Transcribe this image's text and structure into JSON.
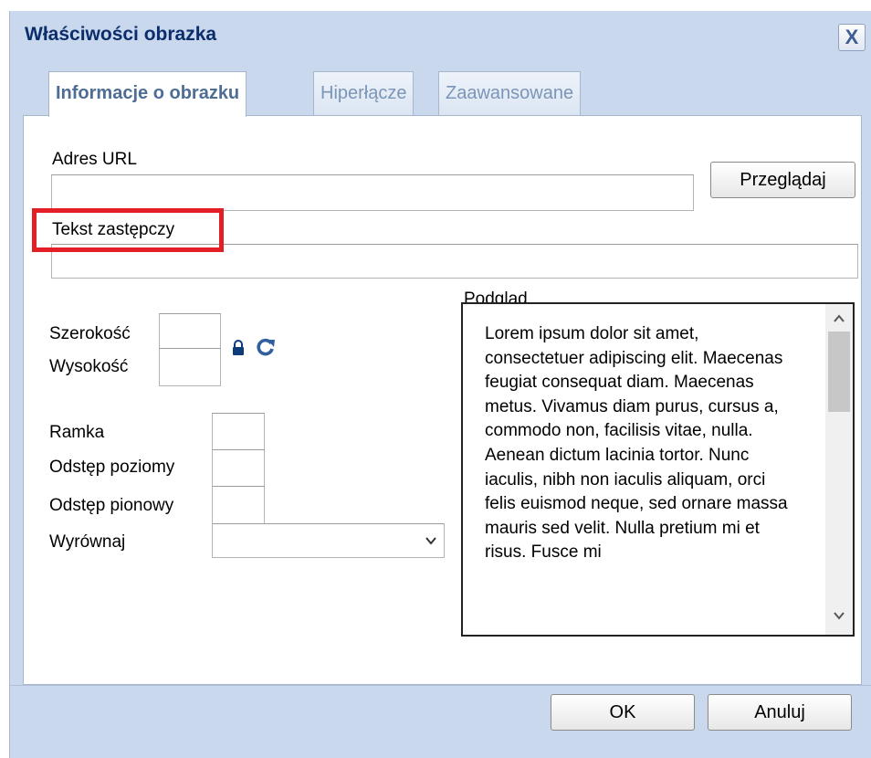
{
  "dialog": {
    "title": "Właściwości obrazka",
    "close_label": "X"
  },
  "tabs": [
    {
      "label": "Informacje o obrazku",
      "active": true
    },
    {
      "label": "Hiperłącze",
      "active": false
    },
    {
      "label": "Zaawansowane",
      "active": false
    }
  ],
  "fields": {
    "url_label": "Adres URL",
    "url_value": "",
    "browse_label": "Przeglądaj",
    "alt_label": "Tekst zastępczy",
    "alt_value": "",
    "width_label": "Szerokość",
    "height_label": "Wysokość",
    "border_label": "Ramka",
    "hspace_label": "Odstęp poziomy",
    "vspace_label": "Odstęp pionowy",
    "align_label": "Wyrównaj",
    "align_value": ""
  },
  "icons": {
    "lock": "lock-icon",
    "reset": "reset-size-icon",
    "dropdown": "chevron-down-icon"
  },
  "preview": {
    "label": "Podgląd",
    "text": "Lorem ipsum dolor sit amet, consectetuer adipiscing elit. Maecenas feugiat consequat diam. Maecenas metus. Vivamus diam purus, cursus a, commodo non, facilisis vitae, nulla. Aenean dictum lacinia tortor. Nunc iaculis, nibh non iaculis aliquam, orci felis euismod neque, sed ornare massa mauris sed velit. Nulla pretium mi et risus. Fusce mi"
  },
  "footer": {
    "ok_label": "OK",
    "cancel_label": "Anuluj"
  },
  "colors": {
    "dialog_bg": "#c9d8ec",
    "title": "#0b2d6b",
    "highlight": "#e31e24"
  }
}
